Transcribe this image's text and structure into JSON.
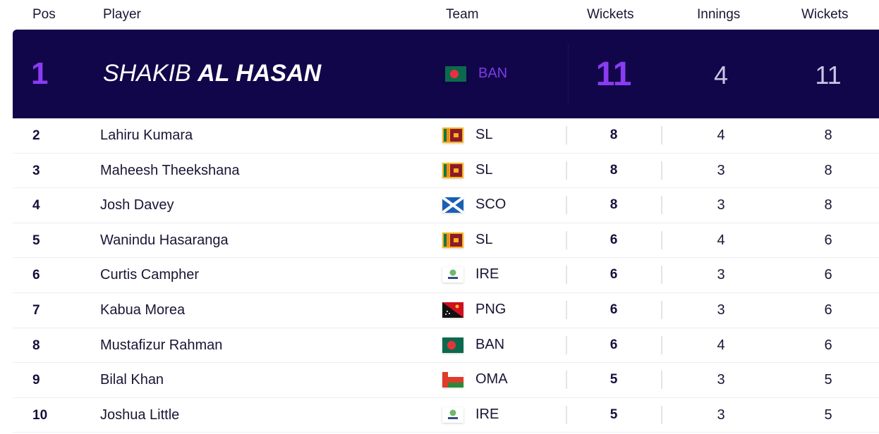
{
  "header": {
    "pos": "Pos",
    "player": "Player",
    "team": "Team",
    "wickets": "Wickets",
    "innings": "Innings",
    "wickets2": "Wickets"
  },
  "colors": {
    "leader_bg": "#12064a",
    "accent_purple": "#8a3cf0",
    "text_dark": "#14103a"
  },
  "leader": {
    "pos": "1",
    "first_name": "SHAKIB",
    "last_name": "AL HASAN",
    "team": "BAN",
    "flag": "bangladesh-flag",
    "wickets": "11",
    "innings": "4",
    "wickets2": "11"
  },
  "rows": [
    {
      "pos": "2",
      "name": "Lahiru Kumara",
      "team": "SL",
      "flag": "sri-lanka-flag",
      "wickets": "8",
      "innings": "4",
      "wickets2": "8"
    },
    {
      "pos": "3",
      "name": "Maheesh Theekshana",
      "team": "SL",
      "flag": "sri-lanka-flag",
      "wickets": "8",
      "innings": "3",
      "wickets2": "8"
    },
    {
      "pos": "4",
      "name": "Josh Davey",
      "team": "SCO",
      "flag": "scotland-flag",
      "wickets": "8",
      "innings": "3",
      "wickets2": "8"
    },
    {
      "pos": "5",
      "name": "Wanindu Hasaranga",
      "team": "SL",
      "flag": "sri-lanka-flag",
      "wickets": "6",
      "innings": "4",
      "wickets2": "6"
    },
    {
      "pos": "6",
      "name": "Curtis Campher",
      "team": "IRE",
      "flag": "ireland-cricket-logo",
      "wickets": "6",
      "innings": "3",
      "wickets2": "6"
    },
    {
      "pos": "7",
      "name": "Kabua Morea",
      "team": "PNG",
      "flag": "papua-new-guinea-flag",
      "wickets": "6",
      "innings": "3",
      "wickets2": "6"
    },
    {
      "pos": "8",
      "name": "Mustafizur Rahman",
      "team": "BAN",
      "flag": "bangladesh-flag",
      "wickets": "6",
      "innings": "4",
      "wickets2": "6"
    },
    {
      "pos": "9",
      "name": "Bilal Khan",
      "team": "OMA",
      "flag": "oman-flag",
      "wickets": "5",
      "innings": "3",
      "wickets2": "5"
    },
    {
      "pos": "10",
      "name": "Joshua Little",
      "team": "IRE",
      "flag": "ireland-cricket-logo",
      "wickets": "5",
      "innings": "3",
      "wickets2": "5"
    }
  ]
}
